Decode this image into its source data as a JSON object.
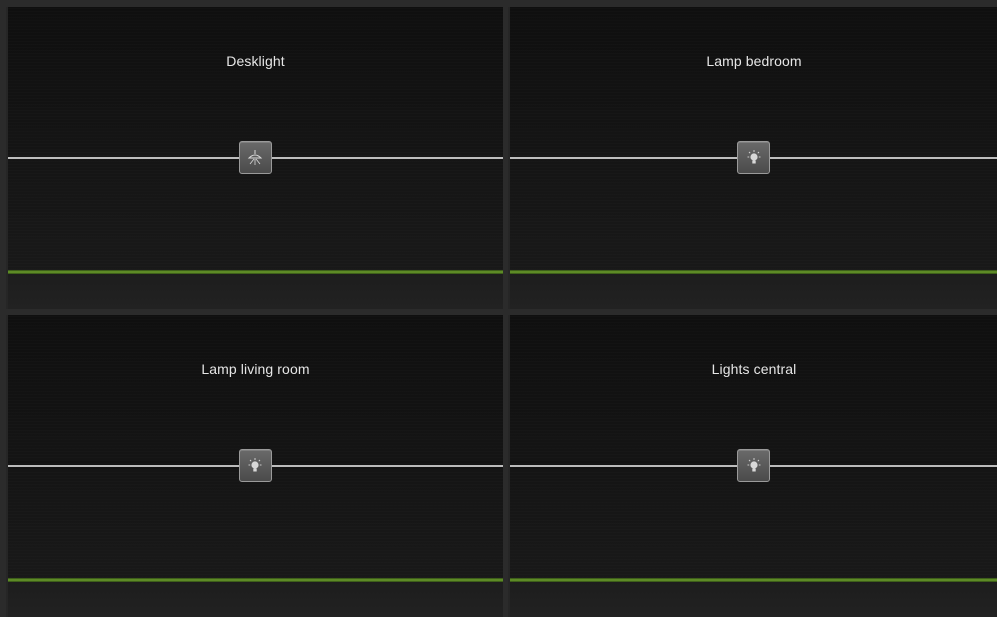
{
  "tiles": [
    {
      "title": "Desklight",
      "icon": "ceiling-lamp-icon",
      "level": 0.5,
      "status_color": "#6d9f2c"
    },
    {
      "title": "Lamp bedroom",
      "icon": "light-bulb-icon",
      "level": 0.5,
      "status_color": "#6d9f2c"
    },
    {
      "title": "Lamp living room",
      "icon": "light-bulb-icon",
      "level": 0.5,
      "status_color": "#6d9f2c"
    },
    {
      "title": "Lights central",
      "icon": "light-bulb-icon",
      "level": 0.5,
      "status_color": "#6d9f2c"
    }
  ]
}
